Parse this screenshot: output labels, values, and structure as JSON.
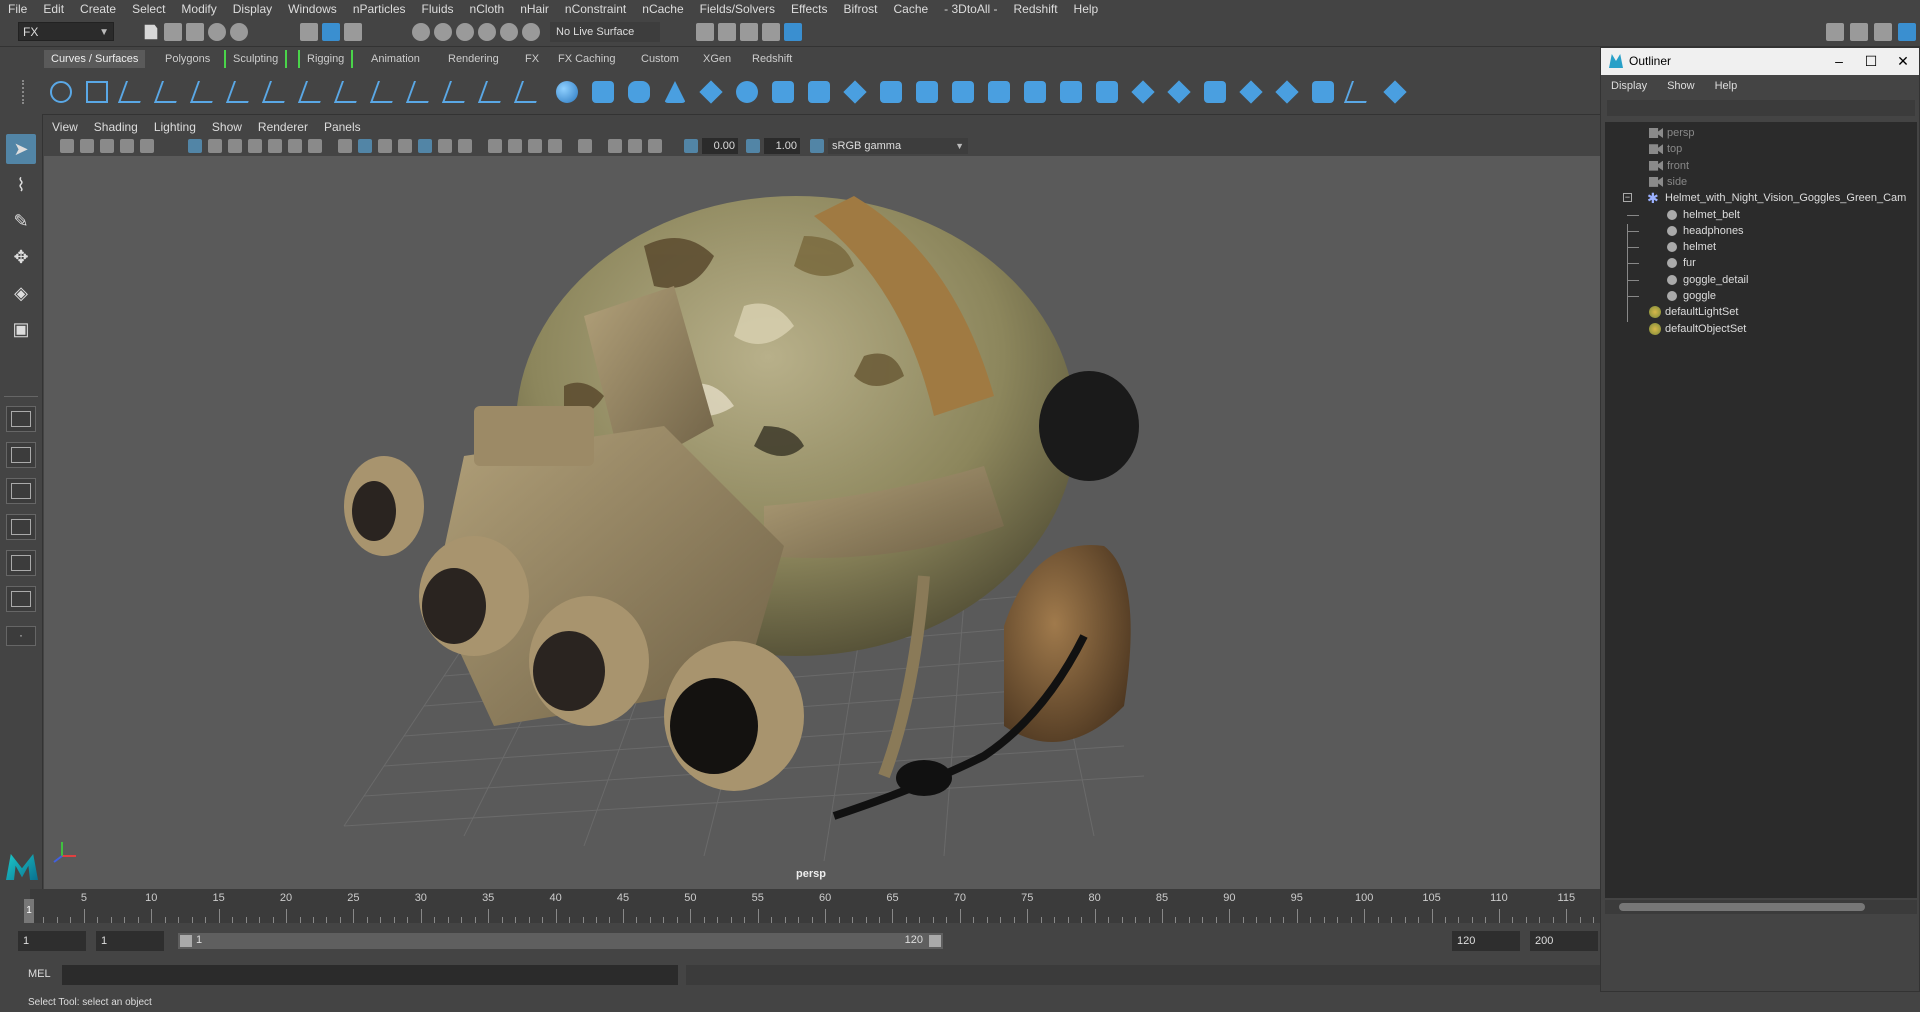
{
  "menubar": [
    "File",
    "Edit",
    "Create",
    "Select",
    "Modify",
    "Display",
    "Windows",
    "nParticles",
    "Fluids",
    "nCloth",
    "nHair",
    "nConstraint",
    "nCache",
    "Fields/Solvers",
    "Effects",
    "Bifrost",
    "Cache",
    "- 3DtoAll -",
    "Redshift",
    "Help"
  ],
  "status_line": {
    "menu_set": "FX",
    "live_surface": "No Live Surface"
  },
  "shelf_tabs": [
    "Curves / Surfaces",
    "Polygons",
    "Sculpting",
    "Rigging",
    "Animation",
    "Rendering",
    "FX",
    "FX Caching",
    "Custom",
    "XGen",
    "Redshift"
  ],
  "viewport": {
    "menu": [
      "View",
      "Shading",
      "Lighting",
      "Show",
      "Renderer",
      "Panels"
    ],
    "exposure": "0.00",
    "gamma_value": "1.00",
    "color_space": "sRGB gamma",
    "camera_label": "persp"
  },
  "timeslider": {
    "ticks": [
      "5",
      "10",
      "15",
      "20",
      "25",
      "30",
      "35",
      "40",
      "45",
      "50",
      "55",
      "60",
      "65",
      "70",
      "75",
      "80",
      "85",
      "90",
      "95",
      "100",
      "105",
      "110",
      "115"
    ],
    "current_frame": "1"
  },
  "range": {
    "start_field": "1",
    "start_field2": "1",
    "range_start": "1",
    "range_end": "120",
    "end_field": "120",
    "end_field2": "200"
  },
  "command_line": {
    "label": "MEL"
  },
  "help_line": "Select Tool: select an object",
  "outliner": {
    "title": "Outliner",
    "menu": [
      "Display",
      "Show",
      "Help"
    ],
    "cameras": [
      "persp",
      "top",
      "front",
      "side"
    ],
    "group": "Helmet_with_Night_Vision_Goggles_Green_Cam",
    "children": [
      "helmet_belt",
      "headphones",
      "helmet",
      "fur",
      "goggle_detail",
      "goggle"
    ],
    "sets": [
      "defaultLightSet",
      "defaultObjectSet"
    ]
  },
  "colors": {
    "accent_blue": "#5285a6",
    "shelf_blue": "#4a9fe0",
    "helmet_tan": "#a89870",
    "highlight_green": "#4ad44a"
  }
}
